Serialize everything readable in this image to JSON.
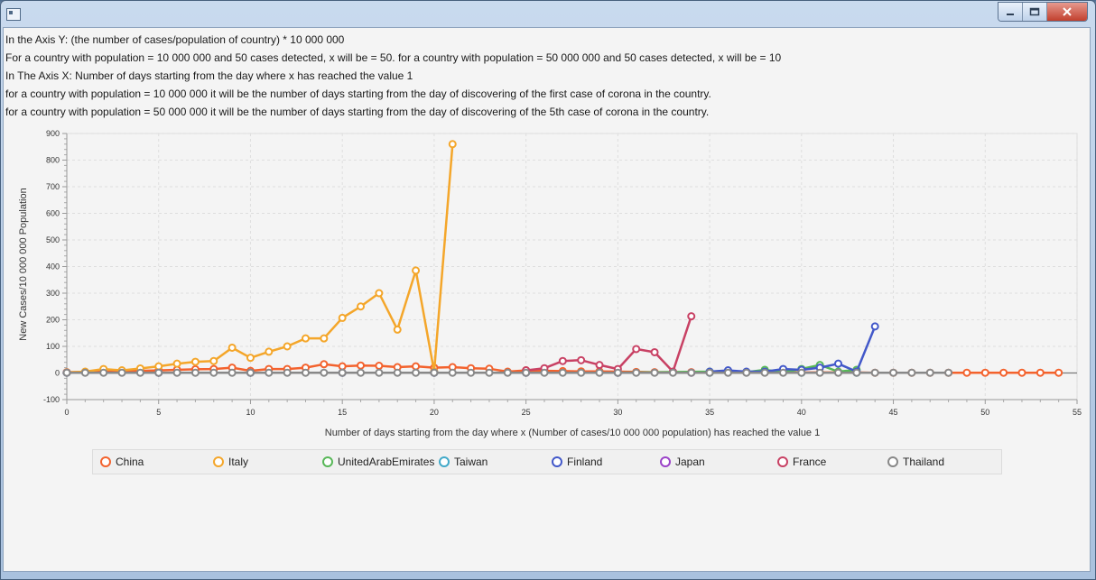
{
  "window": {
    "minimize_icon": "minimize-icon",
    "maximize_icon": "maximize-icon",
    "close_icon": "close-icon"
  },
  "info": [
    "In the Axis Y: (the number of cases/population of country) * 10 000 000",
    "For a country with population = 10 000 000 and 50 cases detected, x will be = 50. for a country with population = 50 000 000 and 50 cases detected, x will be = 10",
    "In The Axis X: Number of days starting from the day where x has reached the value 1",
    "for a country with population = 10 000 000 it will be the number of days starting from the day of discovering of the first case of corona in the country.",
    "for a country with population = 50 000 000 it will be the number of days starting from the day of discovering of the 5th case of corona in the country."
  ],
  "chart_data": {
    "type": "line",
    "xlabel": "Number of days starting from the day where x (Number of cases/10 000 000 population) has reached the value 1",
    "ylabel": "New Cases/10 000 000 Population",
    "xlim": [
      0,
      55
    ],
    "ylim": [
      -100,
      900
    ],
    "xticks": [
      "0",
      "5",
      "10",
      "15",
      "20",
      "25",
      "30",
      "35",
      "40",
      "45",
      "50",
      "55"
    ],
    "yticks": [
      "-100",
      "0",
      "100",
      "200",
      "300",
      "400",
      "500",
      "600",
      "700",
      "800",
      "900"
    ],
    "grid": true,
    "legend_position": "bottom",
    "series": [
      {
        "name": "China",
        "color": "#f3622d",
        "x": [
          0,
          1,
          2,
          3,
          4,
          5,
          6,
          7,
          8,
          9,
          10,
          11,
          12,
          13,
          14,
          15,
          16,
          17,
          18,
          19,
          20,
          21,
          22,
          23,
          24,
          25,
          26,
          27,
          28,
          29,
          30,
          31,
          32,
          33,
          34,
          35,
          36,
          37,
          38,
          39,
          40,
          41,
          42,
          43,
          44,
          45,
          46,
          47,
          48,
          49,
          50,
          51,
          52,
          53,
          54
        ],
        "y": [
          3,
          4,
          5,
          6,
          8,
          10,
          12,
          14,
          15,
          20,
          8,
          15,
          15,
          20,
          33,
          25,
          28,
          27,
          22,
          25,
          20,
          22,
          18,
          16,
          5,
          10,
          8,
          7,
          6,
          6,
          5,
          4,
          3,
          3,
          3,
          3,
          2,
          2,
          2,
          2,
          2,
          2,
          2,
          2,
          1,
          1,
          1,
          1,
          1,
          1,
          1,
          1,
          1,
          1,
          1
        ]
      },
      {
        "name": "Italy",
        "color": "#f4a62a",
        "x": [
          0,
          1,
          2,
          3,
          4,
          5,
          6,
          7,
          8,
          9,
          10,
          11,
          12,
          13,
          14,
          15,
          16,
          17,
          18,
          19,
          20,
          21
        ],
        "y": [
          2,
          5,
          15,
          10,
          17,
          25,
          35,
          42,
          45,
          95,
          57,
          80,
          100,
          130,
          130,
          207,
          250,
          300,
          163,
          385,
          5,
          860
        ]
      },
      {
        "name": "UnitedArabEmirates",
        "color": "#57b757",
        "x": [
          0,
          5,
          10,
          15,
          20,
          25,
          30,
          35,
          36,
          37,
          38,
          39,
          40,
          41,
          42,
          43
        ],
        "y": [
          1,
          1,
          1,
          1,
          1,
          1,
          1,
          5,
          8,
          3,
          12,
          3,
          15,
          30,
          5,
          12
        ]
      },
      {
        "name": "Taiwan",
        "color": "#41a9c9",
        "x": [
          0,
          5,
          10,
          15,
          20,
          25,
          30,
          35,
          40,
          43
        ],
        "y": [
          1,
          1,
          1,
          1,
          1,
          1,
          1,
          1,
          1,
          1
        ]
      },
      {
        "name": "Finland",
        "color": "#4258c9",
        "x": [
          35,
          36,
          37,
          38,
          39,
          40,
          41,
          42,
          43,
          44
        ],
        "y": [
          5,
          10,
          5,
          5,
          15,
          12,
          20,
          35,
          5,
          175
        ]
      },
      {
        "name": "Japan",
        "color": "#9a42c8",
        "x": [
          0,
          5,
          10,
          15,
          20,
          25,
          30,
          34
        ],
        "y": [
          1,
          1,
          1,
          1,
          1,
          1,
          1,
          1
        ]
      },
      {
        "name": "France",
        "color": "#c84164",
        "x": [
          25,
          26,
          27,
          28,
          29,
          30,
          31,
          32,
          33,
          34
        ],
        "y": [
          10,
          18,
          45,
          48,
          30,
          15,
          90,
          78,
          5,
          213
        ]
      },
      {
        "name": "Thailand",
        "color": "#888888",
        "x": [
          0,
          1,
          2,
          3,
          4,
          5,
          6,
          7,
          8,
          9,
          10,
          11,
          12,
          13,
          14,
          15,
          16,
          17,
          18,
          19,
          20,
          21,
          22,
          23,
          24,
          25,
          26,
          27,
          28,
          29,
          30,
          31,
          32,
          33,
          34,
          35,
          36,
          37,
          38,
          39,
          40,
          41,
          42,
          43,
          44,
          45,
          46,
          47,
          48
        ],
        "y": [
          1,
          1,
          1,
          1,
          1,
          1,
          1,
          1,
          1,
          1,
          1,
          1,
          1,
          1,
          1,
          1,
          1,
          1,
          1,
          1,
          1,
          1,
          1,
          1,
          1,
          1,
          1,
          1,
          1,
          1,
          1,
          1,
          1,
          1,
          1,
          1,
          1,
          1,
          1,
          1,
          1,
          1,
          1,
          1,
          1,
          1,
          1,
          1,
          1
        ]
      }
    ]
  }
}
